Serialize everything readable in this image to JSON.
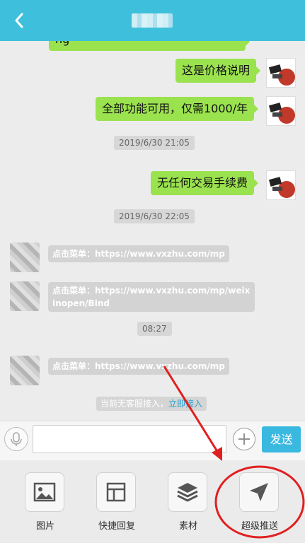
{
  "header": {
    "back_icon": "chevron-left-icon"
  },
  "messages": {
    "partial": "ng",
    "m1": "这是价格说明",
    "m2": "全部功能可用，仅需1000/年",
    "t1": "2019/6/30 21:05",
    "m3": "无任何交易手续费",
    "t2": "2019/6/30 22:05",
    "l1": "点击菜单：https://www.vxzhu.com/mp",
    "l2": "点击菜单：https://www.vxzhu.com/mp/weixinopen/Bind",
    "t3": "08:27",
    "l3": "点击菜单：https://www.vxzhu.com/mp"
  },
  "status": {
    "text": "当前无客服接入，",
    "link": "立即接入"
  },
  "input": {
    "send_label": "发送",
    "value": ""
  },
  "tools": [
    {
      "label": "图片",
      "icon": "image-icon"
    },
    {
      "label": "快捷回复",
      "icon": "quick-reply-icon"
    },
    {
      "label": "素材",
      "icon": "layers-icon"
    },
    {
      "label": "超级推送",
      "icon": "send-plane-icon"
    }
  ],
  "colors": {
    "header": "#3ec0dc",
    "bubble_right": "#9be24f",
    "send_button": "#39b8e0",
    "annotation": "#e02020"
  }
}
